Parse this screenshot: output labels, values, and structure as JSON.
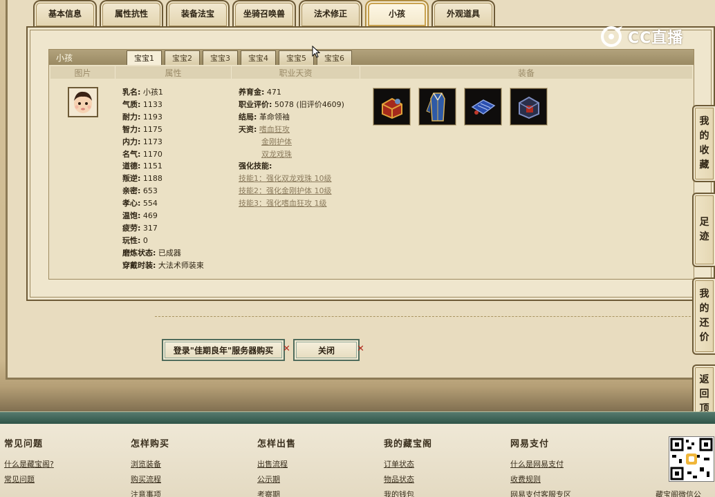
{
  "top_tabs": [
    "基本信息",
    "属性抗性",
    "装备法宝",
    "坐骑召唤兽",
    "法术修正",
    "小孩",
    "外观道具"
  ],
  "active_tab_index": 5,
  "kid_panel": {
    "title": "小孩",
    "sub_tabs": [
      "宝宝1",
      "宝宝2",
      "宝宝3",
      "宝宝4",
      "宝宝5",
      "宝宝6"
    ],
    "active_sub_tab_index": 0,
    "columns": [
      "图片",
      "属性",
      "职业天资",
      "装备"
    ],
    "attributes": [
      {
        "label": "乳名:",
        "value": "小孩1"
      },
      {
        "label": "气质:",
        "value": "1133"
      },
      {
        "label": "耐力:",
        "value": "1193"
      },
      {
        "label": "智力:",
        "value": "1175"
      },
      {
        "label": "内力:",
        "value": "1173"
      },
      {
        "label": "名气:",
        "value": "1170"
      },
      {
        "label": "道德:",
        "value": "1151"
      },
      {
        "label": "叛逆:",
        "value": "1188"
      },
      {
        "label": "亲密:",
        "value": "653"
      },
      {
        "label": "孝心:",
        "value": "554"
      },
      {
        "label": "温饱:",
        "value": "469"
      },
      {
        "label": "疲劳:",
        "value": "317"
      },
      {
        "label": "玩性:",
        "value": "0"
      },
      {
        "label": "磨炼状态:",
        "value": "已成器"
      },
      {
        "label": "穿戴时装:",
        "value": "大法术师装束"
      }
    ],
    "career": {
      "raising_label": "养育金:",
      "raising_value": "471",
      "score_label": "职业评价:",
      "score_value": "5078 (旧评价4609)",
      "ending_label": "结局:",
      "ending_value": "革命领袖",
      "talent_label": "天资:",
      "talents": [
        "嗜血狂攻",
        "金刚护体",
        "双龙戏珠"
      ],
      "skills_label": "强化技能:",
      "skills": [
        "技能1：强化双龙戏珠 10级",
        "技能2：强化金刚护体 10级",
        "技能3：强化嗜血狂攻 1级"
      ]
    },
    "equipment": [
      "red-treasure-chest-icon",
      "blue-robe-icon",
      "blue-scroll-icon",
      "dark-armor-chest-icon"
    ]
  },
  "buttons": {
    "buy_label": "登录\"佳期良年\"服务器购买",
    "close_label": "关闭"
  },
  "side_float": {
    "favorites": "我的收藏",
    "footprints": "足迹",
    "my_offers": "我的还价",
    "back_top": "返回顶部"
  },
  "logo_text": "CC直播",
  "footer": {
    "columns": [
      {
        "title": "常见问题",
        "links": [
          "什么是藏宝阁?",
          "常见问题"
        ]
      },
      {
        "title": "怎样购买",
        "links": [
          "浏览装备",
          "购买流程",
          "注意事项"
        ]
      },
      {
        "title": "怎样出售",
        "links": [
          "出售流程",
          "公示期",
          "考察期"
        ]
      },
      {
        "title": "我的藏宝阁",
        "links": [
          "订单状态",
          "物品状态",
          "我的钱包"
        ]
      },
      {
        "title": "网易支付",
        "links": [
          "什么是网易支付",
          "收费规则",
          "网易支付客服专区"
        ]
      }
    ],
    "cut_text": "藏宝阁微信公"
  },
  "colors": {
    "accent_gold": "#c9a24f",
    "panel_border": "#6d5a36",
    "footer_green": "#2f5548",
    "close_x": "#b12a1d"
  }
}
